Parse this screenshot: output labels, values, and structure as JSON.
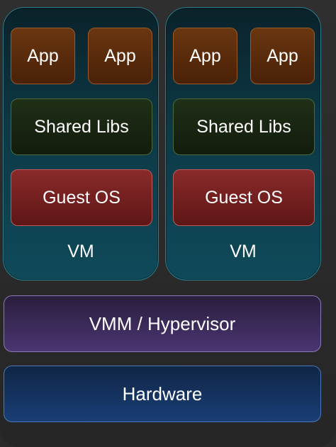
{
  "vms": [
    {
      "apps": [
        "App",
        "App"
      ],
      "libs": "Shared Libs",
      "guest_os": "Guest OS",
      "label": "VM"
    },
    {
      "apps": [
        "App",
        "App"
      ],
      "libs": "Shared Libs",
      "guest_os": "Guest OS",
      "label": "VM"
    }
  ],
  "hypervisor": "VMM / Hypervisor",
  "hardware": "Hardware",
  "colors": {
    "vm_border": "#2b7e8c",
    "app_fill": "#5a2b0c",
    "libs_fill": "#18240f",
    "guest_fill": "#7a2222",
    "hypervisor_fill": "#3a2a5a",
    "hardware_fill": "#15325e"
  }
}
